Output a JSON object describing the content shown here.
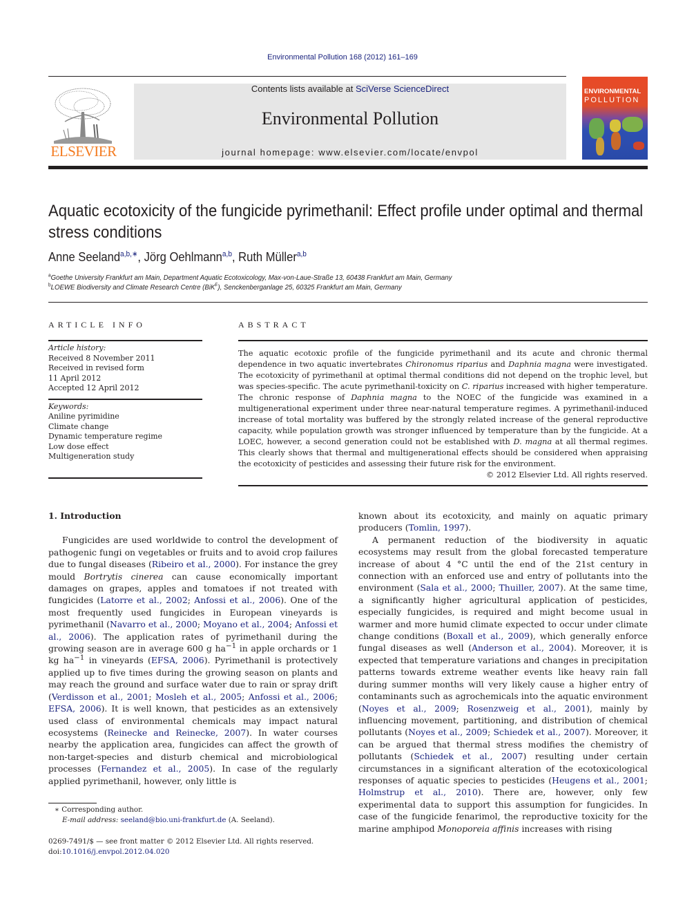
{
  "running_head": "Environmental Pollution 168 (2012) 161–169",
  "publisher": {
    "logo_word": "ELSEVIER",
    "logo_color": "#f47b20"
  },
  "masthead": {
    "contents_prefix": "Contents lists available at ",
    "contents_link": "SciVerse ScienceDirect",
    "journal_title": "Environmental Pollution",
    "homepage": "journal homepage: www.elsevier.com/locate/envpol"
  },
  "cover": {
    "line1": "ENVIRONMENTAL",
    "line2": "POLLUTION"
  },
  "article": {
    "title": "Aquatic ecotoxicity of the fungicide pyrimethanil: Effect profile under optimal and thermal stress conditions",
    "authors": [
      {
        "name": "Anne Seeland",
        "sup": "a,b,∗",
        "sep": ", "
      },
      {
        "name": "Jörg Oehlmann",
        "sup": "a,b",
        "sep": ", "
      },
      {
        "name": "Ruth Müller",
        "sup": "a,b",
        "sep": ""
      }
    ],
    "affiliations": [
      {
        "key": "a",
        "text": "Goethe University Frankfurt am Main, Department Aquatic Ecotoxicology, Max-von-Laue-Straße 13, 60438 Frankfurt am Main, Germany"
      },
      {
        "key": "b",
        "text_before": "LOEWE Biodiversity and Climate Research Centre (BiK",
        "text_sup": "F",
        "text_after": "), Senckenberganlage 25, 60325 Frankfurt am Main, Germany"
      }
    ]
  },
  "article_info": {
    "heading": "ARTICLE INFO",
    "history_label": "Article history:",
    "history": [
      "Received 8 November 2011",
      "Received in revised form",
      "11 April 2012",
      "Accepted 12 April 2012"
    ],
    "keywords_label": "Keywords:",
    "keywords": [
      "Aniline pyrimidine",
      "Climate change",
      "Dynamic temperature regime",
      "Low dose effect",
      "Multigeneration study"
    ]
  },
  "abstract": {
    "heading": "ABSTRACT",
    "segments": [
      {
        "t": "The aquatic ecotoxic profile of the fungicide pyrimethanil and its acute and chronic thermal dependence in two aquatic invertebrates "
      },
      {
        "t": "Chironomus riparius",
        "i": true
      },
      {
        "t": " and "
      },
      {
        "t": "Daphnia magna",
        "i": true
      },
      {
        "t": " were investigated. The ecotoxicity of pyrimethanil at optimal thermal conditions did not depend on the trophic level, but was species-specific. The acute pyrimethanil-toxicity on "
      },
      {
        "t": "C. riparius",
        "i": true
      },
      {
        "t": " increased with higher temperature. The chronic response of "
      },
      {
        "t": "Daphnia magna",
        "i": true
      },
      {
        "t": " to the NOEC of the fungicide was examined in a multigenerational experiment under three near-natural temperature regimes. A pyrimethanil-induced increase of total mortality was buffered by the strongly related increase of the general reproductive capacity, while population growth was stronger influenced by temperature than by the fungicide. At a LOEC, however, a second generation could not be established with "
      },
      {
        "t": "D. magna",
        "i": true
      },
      {
        "t": " at all thermal regimes. This clearly shows that thermal and multigenerational effects should be considered when appraising the ecotoxicity of pesticides and assessing their future risk for the environment."
      }
    ],
    "copyright": "© 2012 Elsevier Ltd. All rights reserved."
  },
  "introduction": {
    "heading": "1.  Introduction",
    "left_paragraphs": [
      [
        {
          "t": "Fungicides are used worldwide to control the development of pathogenic fungi on vegetables or fruits and to avoid crop failures due to fungal diseases ("
        },
        {
          "t": "Ribeiro et al., 2000",
          "link": true
        },
        {
          "t": "). For instance the grey mould "
        },
        {
          "t": "Bortrytis cinerea",
          "i": true
        },
        {
          "t": " can cause economically important damages on grapes, apples and tomatoes if not treated with fungicides ("
        },
        {
          "t": "Latorre et al., 2002",
          "link": true
        },
        {
          "t": "; "
        },
        {
          "t": "Anfossi et al., 2006",
          "link": true
        },
        {
          "t": "). One of the most frequently used fungicides in European vineyards is pyrimethanil ("
        },
        {
          "t": "Navarro et al., 2000",
          "link": true
        },
        {
          "t": "; "
        },
        {
          "t": "Moyano et al., 2004",
          "link": true
        },
        {
          "t": "; "
        },
        {
          "t": "Anfossi et al., 2006",
          "link": true
        },
        {
          "t": "). The application rates of pyrimethanil during the growing season are in average 600 g ha"
        },
        {
          "t": "−1",
          "sup": true
        },
        {
          "t": " in apple orchards or 1 kg ha"
        },
        {
          "t": "−1",
          "sup": true
        },
        {
          "t": " in vineyards ("
        },
        {
          "t": "EFSA, 2006",
          "link": true
        },
        {
          "t": "). Pyrimethanil is protectively applied up to five times during the growing season on plants and may reach the ground and surface water due to rain or spray drift ("
        },
        {
          "t": "Verdisson et al., 2001",
          "link": true
        },
        {
          "t": "; "
        },
        {
          "t": "Mosleh et al., 2005",
          "link": true
        },
        {
          "t": "; "
        },
        {
          "t": "Anfossi et al., 2006",
          "link": true
        },
        {
          "t": "; "
        },
        {
          "t": "EFSA, 2006",
          "link": true
        },
        {
          "t": "). It is well known, that pesticides as an extensively used class of environmental chemicals may impact natural ecosystems ("
        },
        {
          "t": "Reinecke and Reinecke, 2007",
          "link": true
        },
        {
          "t": "). In water courses nearby the application area, fungicides can affect the growth of non-target-species and disturb chemical and microbiological processes ("
        },
        {
          "t": "Fernandez et al., 2005",
          "link": true
        },
        {
          "t": "). In case of the regularly applied pyrimethanil, however, only little is"
        }
      ]
    ],
    "right_paragraphs": [
      [
        {
          "t": "known about its ecotoxicity, and mainly on aquatic primary producers ("
        },
        {
          "t": "Tomlin, 1997",
          "link": true
        },
        {
          "t": ")."
        }
      ],
      [
        {
          "t": "A permanent reduction of the biodiversity in aquatic ecosystems may result from the global forecasted temperature increase of about 4 °C until the end of the 21st century in connection with an enforced use and entry of pollutants into the environment ("
        },
        {
          "t": "Sala et al., 2000",
          "link": true
        },
        {
          "t": "; "
        },
        {
          "t": "Thuiller, 2007",
          "link": true
        },
        {
          "t": "). At the same time, a significantly higher agricultural application of pesticides, especially fungicides, is required and might become usual in warmer and more humid climate expected to occur under climate change conditions ("
        },
        {
          "t": "Boxall et al., 2009",
          "link": true
        },
        {
          "t": "), which generally enforce fungal diseases as well ("
        },
        {
          "t": "Anderson et al., 2004",
          "link": true
        },
        {
          "t": "). Moreover, it is expected that temperature variations and changes in precipitation patterns towards extreme weather events like heavy rain fall during summer months will very likely cause a higher entry of contaminants such as agrochemicals into the aquatic environment ("
        },
        {
          "t": "Noyes et al., 2009",
          "link": true
        },
        {
          "t": "; "
        },
        {
          "t": "Rosenzweig et al., 2001",
          "link": true
        },
        {
          "t": "), mainly by influencing movement, partitioning, and distribution of chemical pollutants ("
        },
        {
          "t": "Noyes et al., 2009",
          "link": true
        },
        {
          "t": "; "
        },
        {
          "t": "Schiedek et al., 2007",
          "link": true
        },
        {
          "t": "). Moreover, it can be argued that thermal stress modifies the chemistry of pollutants ("
        },
        {
          "t": "Schiedek et al., 2007",
          "link": true
        },
        {
          "t": ") resulting under certain circumstances in a significant alteration of the ecotoxicological responses of aquatic species to pesticides ("
        },
        {
          "t": "Heugens et al., 2001",
          "link": true
        },
        {
          "t": "; "
        },
        {
          "t": "Holmstrup et al., 2010",
          "link": true
        },
        {
          "t": "). There are, however, only few experimental data to support this assumption for fungicides. In case of the fungicide fenarimol, the reproductive toxicity for the marine amphipod "
        },
        {
          "t": "Monoporeia affinis",
          "i": true
        },
        {
          "t": " increases with rising"
        }
      ]
    ]
  },
  "footnote": {
    "marker": "∗",
    "corresponding": "Corresponding author.",
    "email_label": "E-mail address:",
    "email": "seeland@bio.uni-frankfurt.de",
    "email_suffix": " (A. Seeland)."
  },
  "front_matter": {
    "issn_line": "0269-7491/$ — see front matter © 2012 Elsevier Ltd. All rights reserved.",
    "doi_label": "doi:",
    "doi": "10.1016/j.envpol.2012.04.020"
  },
  "colors": {
    "link": "#1a237e",
    "masthead_bg": "#e6e6e6",
    "elsevier_orange": "#f47b20"
  }
}
